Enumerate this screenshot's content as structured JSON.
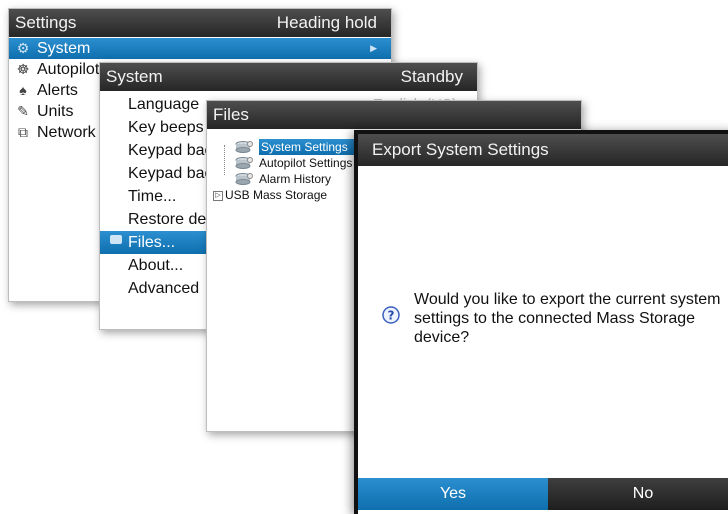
{
  "settings": {
    "title": "Settings",
    "mode": "Heading hold",
    "items": [
      {
        "label": "System",
        "icon": "gear-icon",
        "selected": true
      },
      {
        "label": "Autopilot",
        "icon": "helm-icon",
        "selected": false
      },
      {
        "label": "Alerts",
        "icon": "bell-icon",
        "selected": false
      },
      {
        "label": "Units",
        "icon": "pencil-icon",
        "selected": false
      },
      {
        "label": "Network",
        "icon": "network-icon",
        "selected": false
      }
    ]
  },
  "system": {
    "title": "System",
    "mode": "Standby",
    "items": [
      {
        "label": "Language",
        "value": "English (US)"
      },
      {
        "label": "Key beeps"
      },
      {
        "label": "Keypad backlight"
      },
      {
        "label": "Keypad backlight"
      },
      {
        "label": "Time..."
      },
      {
        "label": "Restore defaults"
      },
      {
        "label": "Files...",
        "selected": true,
        "icon": "folder-icon"
      },
      {
        "label": "About..."
      },
      {
        "label": "Advanced"
      }
    ]
  },
  "files": {
    "title": "Files",
    "tree": [
      {
        "label": "System Settings",
        "level": 1,
        "selected": true
      },
      {
        "label": "Autopilot Settings",
        "level": 1
      },
      {
        "label": "Alarm History",
        "level": 1
      },
      {
        "label": "USB Mass Storage",
        "level": 0
      }
    ]
  },
  "export": {
    "title": "Export System Settings",
    "message": "Would you like to export the current system settings to the connected Mass Storage device?",
    "yes_label": "Yes",
    "no_label": "No"
  },
  "colors": {
    "accent": "#1a7fc1",
    "titlebar": "#333333"
  }
}
